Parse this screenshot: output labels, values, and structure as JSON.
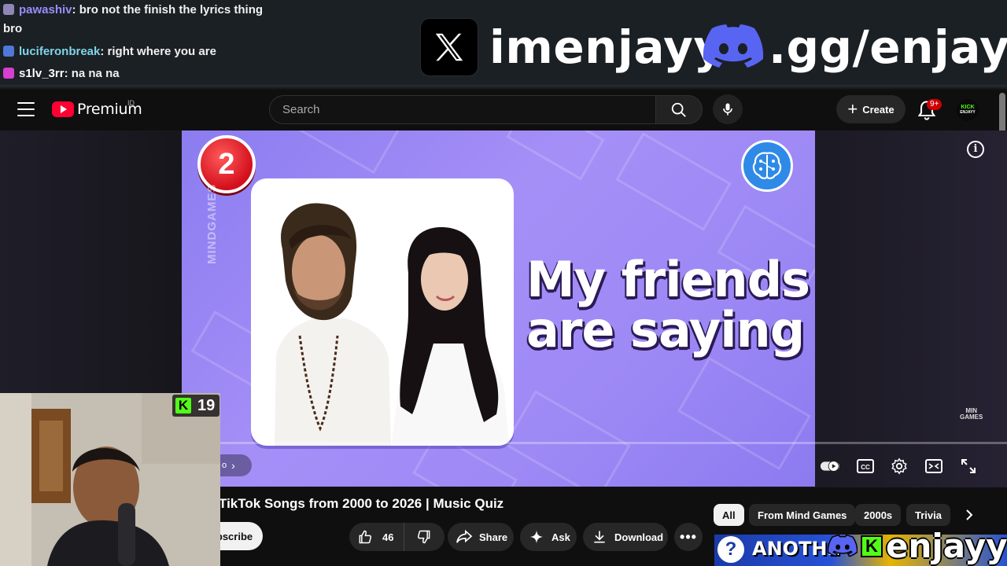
{
  "chat": [
    {
      "user": "pawashiv",
      "message": ": bro not the finish the lyrics thing",
      "user_color": "#9b8cff",
      "badge_color": "#8f86b7"
    },
    {
      "user": "",
      "message": "bro",
      "user_color": "#ffffff",
      "badge_color": ""
    },
    {
      "user": "luciferonbreak",
      "message": ": right where you are",
      "user_color": "#7fd6e8",
      "badge_color": "#4f78d8"
    },
    {
      "user": "s1lv_3rr",
      "message": ": na na na",
      "user_color": "#ffffff",
      "badge_color": "#d63fd0"
    }
  ],
  "overlay": {
    "x_handle": "imenjayy",
    "discord_handle": ".gg/enjayy",
    "bottom_handle": "enjayy",
    "kick_viewers": "19"
  },
  "header": {
    "premium_label": "Premium",
    "country": "ID",
    "search_placeholder": "Search",
    "create_label": "Create",
    "notif_count": "9+",
    "avatar_text_1": "KICK",
    "avatar_text_2": "ENJAYY"
  },
  "video": {
    "number": "2",
    "lyric": "My friends are saying",
    "channel_watermark": "MINDGAMES",
    "corner_watermark_1": "MIN",
    "corner_watermark_2": "GAMES",
    "progress_fraction": 0.0
  },
  "player_controls": {
    "pip_label": "o"
  },
  "below": {
    "title": "TikTok Songs from 2000 to 2026 | Music Quiz",
    "subscribe_label": "bscribe",
    "like_count": "46",
    "share_label": "Share",
    "ask_label": "Ask",
    "download_label": "Download"
  },
  "chips": [
    "All",
    "From Mind Games",
    "2000s",
    "Trivia"
  ],
  "thumbnail": {
    "text": "ANOTHE"
  },
  "colors": {
    "brand_red": "#ff0033",
    "kick_green": "#53fc18",
    "discord_blurple": "#5865f2",
    "video_purple": "#9d89f5"
  }
}
